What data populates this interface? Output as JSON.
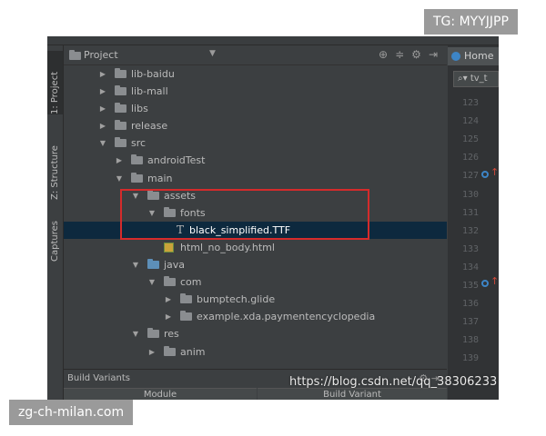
{
  "badges": {
    "top_right": "TG: MYYJJPP",
    "bottom_left": "zg-ch-milan.com"
  },
  "watermark": "https://blog.csdn.net/qq_38306233",
  "side_tabs": {
    "project": "1: Project",
    "structure": "Z: Structure",
    "captures": "Captures"
  },
  "panel": {
    "title": "Project",
    "icons": [
      "target-icon",
      "collapse-icon",
      "gear-icon",
      "hide-icon"
    ]
  },
  "tree": [
    {
      "label": "lib-baidu",
      "depth": 0,
      "arrow": "▶",
      "icon": "folder"
    },
    {
      "label": "lib-mall",
      "depth": 0,
      "arrow": "▶",
      "icon": "folder"
    },
    {
      "label": "libs",
      "depth": 0,
      "arrow": "▶",
      "icon": "folder"
    },
    {
      "label": "release",
      "depth": 0,
      "arrow": "▶",
      "icon": "folder"
    },
    {
      "label": "src",
      "depth": 0,
      "arrow": "▼",
      "icon": "folder"
    },
    {
      "label": "androidTest",
      "depth": 1,
      "arrow": "▶",
      "icon": "folder"
    },
    {
      "label": "main",
      "depth": 1,
      "arrow": "▼",
      "icon": "folder"
    },
    {
      "label": "assets",
      "depth": 2,
      "arrow": "▼",
      "icon": "folder"
    },
    {
      "label": "fonts",
      "depth": 3,
      "arrow": "▼",
      "icon": "folder"
    },
    {
      "label": "black_simplified.TTF",
      "depth": 4,
      "arrow": "",
      "icon": "ttf",
      "selected": true
    },
    {
      "label": "html_no_body.html",
      "depth": 3,
      "arrow": "",
      "icon": "html"
    },
    {
      "label": "java",
      "depth": 2,
      "arrow": "▼",
      "icon": "folder-blue"
    },
    {
      "label": "com",
      "depth": 3,
      "arrow": "▼",
      "icon": "folder"
    },
    {
      "label": "bumptech.glide",
      "depth": 4,
      "arrow": "▶",
      "icon": "folder"
    },
    {
      "label": "example.xda.paymentencyclopedia",
      "depth": 4,
      "arrow": "▶",
      "icon": "folder"
    },
    {
      "label": "res",
      "depth": 2,
      "arrow": "▼",
      "icon": "folder"
    },
    {
      "label": "anim",
      "depth": 3,
      "arrow": "▶",
      "icon": "folder"
    }
  ],
  "editor": {
    "tab": "Home",
    "search": "tv_t",
    "line_numbers": [
      "123",
      "124",
      "125",
      "126",
      "127",
      "130",
      "131",
      "132",
      "133",
      "134",
      "135",
      "136",
      "137",
      "138",
      "139"
    ]
  },
  "build_variants": {
    "title": "Build Variants",
    "col_module": "Module",
    "col_variant": "Build Variant"
  }
}
